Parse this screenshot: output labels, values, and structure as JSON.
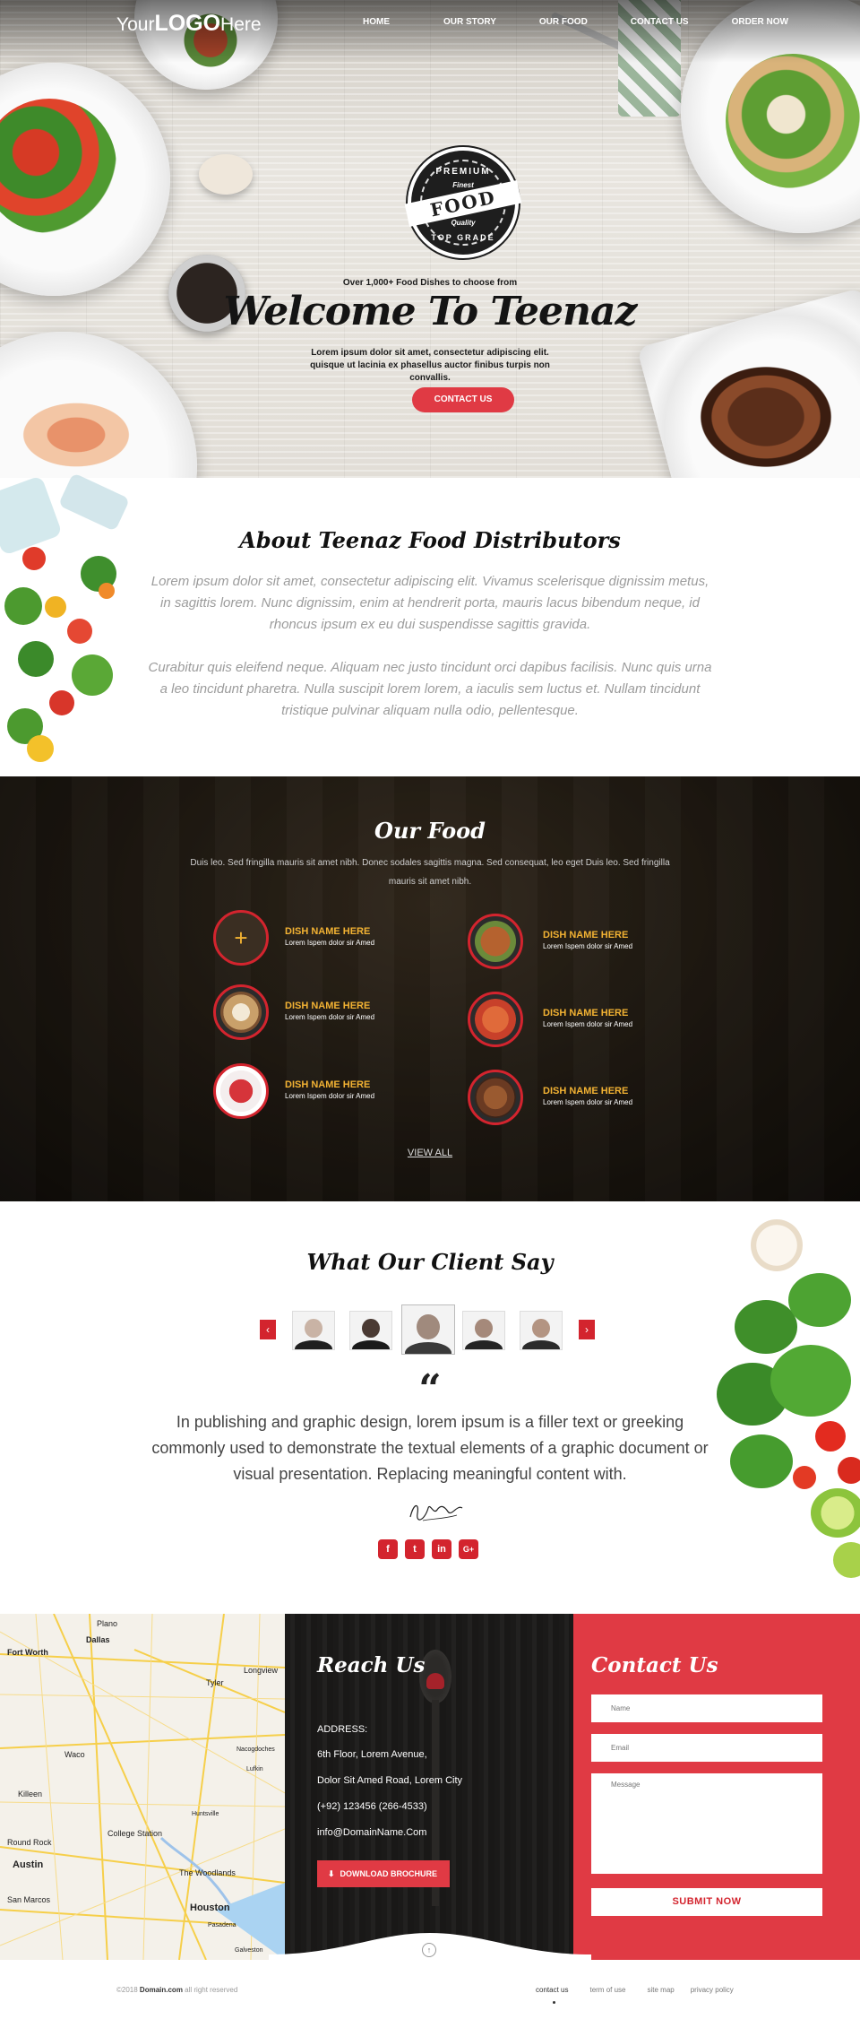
{
  "header": {
    "logo": {
      "pre": "Your",
      "bold": "LOGO",
      "post": "Here"
    },
    "nav": [
      "HOME",
      "OUR STORY",
      "OUR FOOD",
      "CONTACT US",
      "ORDER NOW"
    ]
  },
  "hero": {
    "badge": {
      "top": "PREMIUM",
      "band": "FOOD",
      "script": "Finest",
      "quality": "Quality",
      "bottom": "TOP GRADE"
    },
    "subtitle": "Over 1,000+ Food Dishes to choose from",
    "title": "Welcome To Teenaz",
    "text": "Lorem ipsum dolor sit amet, consectetur adipiscing elit. quisque ut lacinia ex phasellus auctor finibus turpis non convallis.",
    "button": "CONTACT US"
  },
  "about": {
    "title": "About Teenaz Food Distributors",
    "paragraphs": [
      "Lorem ipsum dolor sit amet, consectetur adipiscing elit. Vivamus scelerisque dignissim metus, in sagittis lorem. Nunc dignissim, enim at hendrerit porta, mauris lacus bibendum neque, id rhoncus ipsum ex eu dui suspendisse sagittis gravida.",
      "Curabitur quis eleifend neque. Aliquam nec justo tincidunt orci dapibus facilisis. Nunc quis urna a leo tincidunt pharetra. Nulla suscipit lorem lorem, a iaculis sem luctus et. Nullam tincidunt tristique pulvinar aliquam nulla odio, pellentesque."
    ]
  },
  "our_food": {
    "title": "Our Food",
    "intro": "Duis leo. Sed fringilla mauris sit amet nibh. Donec sodales sagittis magna. Sed consequat, leo eget   Duis leo. Sed fringilla mauris sit amet nibh.",
    "dishes": [
      {
        "name": "DISH NAME HERE",
        "desc": "Lorem Ispem dolor sir Amed",
        "icon": "plus-icon",
        "color": "#3a2e22"
      },
      {
        "name": "DISH NAME HERE",
        "desc": "Lorem Ispem dolor sir Amed",
        "icon": "dish-photo",
        "color": "#b5622f"
      },
      {
        "name": "DISH NAME HERE",
        "desc": "Lorem Ispem dolor sir Amed",
        "icon": "dish-photo",
        "color": "#c9a06a"
      },
      {
        "name": "DISH NAME HERE",
        "desc": "Lorem Ispem dolor sir Amed",
        "icon": "dish-photo",
        "color": "#c8402a"
      },
      {
        "name": "DISH NAME HERE",
        "desc": "Lorem Ispem dolor sir Amed",
        "icon": "dish-photo",
        "color": "#e9e0d8"
      },
      {
        "name": "DISH NAME HERE",
        "desc": "Lorem Ispem dolor sir Amed",
        "icon": "dish-photo",
        "color": "#6a3a22"
      }
    ],
    "view_all": "VIEW ALL"
  },
  "testimonials": {
    "title": "What Our Client Say",
    "quote_mark": "“",
    "quote": "In publishing and graphic design, lorem ipsum is a filler text or greeking commonly used to demonstrate the textual elements of a graphic document or visual presentation. Replacing meaningful content with.",
    "prev": "‹",
    "next": "›",
    "socials": [
      "f",
      "t",
      "in",
      "G+"
    ]
  },
  "map": {
    "labels": [
      "Plano",
      "Dallas",
      "Fort Worth",
      "Tyler",
      "Longview",
      "Nacogdoches",
      "Waco",
      "Killeen",
      "Lufkin",
      "Round Rock",
      "College Station",
      "Austin",
      "The Woodlands",
      "Houston",
      "San Marcos",
      "Pasadena",
      "Galveston",
      "Huntsville"
    ]
  },
  "reach": {
    "title": "Reach Us",
    "address_label": "ADDRESS:",
    "address_line1": "6th Floor, Lorem Avenue,",
    "address_line2": "Dolor Sit Amed Road, Lorem City",
    "phone": "(+92) 123456 (266-4533)",
    "email": "info@DomainName.Com",
    "download": "DOWNLOAD BROCHURE"
  },
  "contact": {
    "title": "Contact Us",
    "name_placeholder": "Name",
    "email_placeholder": "Email",
    "message_placeholder": "Message",
    "submit": "SUBMIT NOW"
  },
  "footer": {
    "copy_pre": "©2018 ",
    "copy_domain": "Domain.com",
    "copy_post": " all right reserved",
    "links": [
      "contact us",
      "term of use",
      "site map",
      "privacy policy"
    ]
  },
  "colors": {
    "accent": "#e03a44",
    "dark_accent": "#d3242e",
    "gold": "#f2b233"
  }
}
